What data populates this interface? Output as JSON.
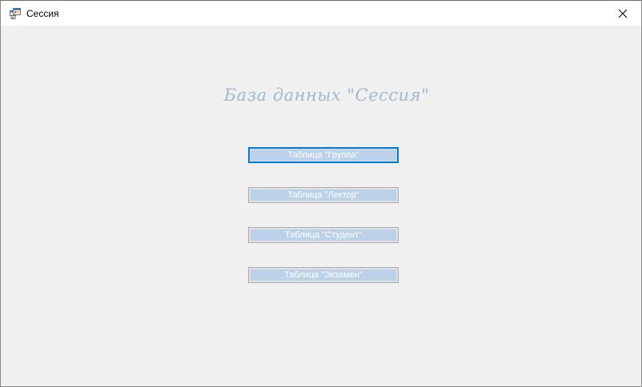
{
  "window": {
    "title": "Сессия",
    "app_icon": "form-icon",
    "close_icon": "close-icon"
  },
  "main": {
    "heading": "База данных \"Сессия\"",
    "buttons": [
      {
        "label": "Таблица \"Группа\"",
        "focused": true
      },
      {
        "label": "Таблица \"Лектор\"",
        "focused": false
      },
      {
        "label": "Таблица \"Студент\"",
        "focused": false
      },
      {
        "label": "Таблица \"Экзамен\"",
        "focused": false
      }
    ]
  },
  "colors": {
    "heading": "#a3b8cf",
    "button_face": "#bcd2ea",
    "focus_border": "#0078d7",
    "background": "#f0f0f0"
  }
}
